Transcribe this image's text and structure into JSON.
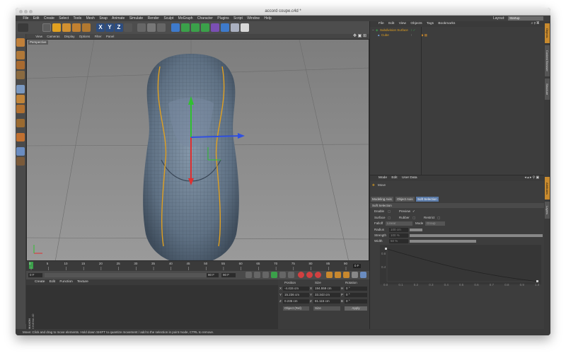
{
  "window": {
    "title": "accord coupe.c4d *"
  },
  "menu": {
    "items": [
      "File",
      "Edit",
      "Create",
      "Select",
      "Tools",
      "Mesh",
      "Snap",
      "Animate",
      "Simulate",
      "Render",
      "Sculpt",
      "MoGraph",
      "Character",
      "Plugins",
      "Script",
      "Window",
      "Help"
    ],
    "layout_label": "Layout:",
    "layout_value": "Startup"
  },
  "viewport": {
    "menu": [
      "View",
      "Cameras",
      "Display",
      "Options",
      "Filter",
      "Panel"
    ],
    "label": "Perspective"
  },
  "timeline": {
    "ticks": [
      "0",
      "5",
      "10",
      "15",
      "20",
      "25",
      "30",
      "35",
      "40",
      "45",
      "50",
      "55",
      "60",
      "65",
      "70",
      "75",
      "80",
      "85",
      "90"
    ],
    "end_frame": "0 F"
  },
  "playback": {
    "start_field": "0 F",
    "current_field": "0 F",
    "end_field": "90 F",
    "max_field": "90 F"
  },
  "material": {
    "menu": [
      "Create",
      "Edit",
      "Function",
      "Texture"
    ],
    "logo_line1": "MAXON",
    "logo_line2": "CINEMA 4D"
  },
  "coordinates": {
    "headers": [
      "Position",
      "Size",
      "Rotation"
    ],
    "rows": [
      {
        "axis": "X",
        "position": "-4.415 cm",
        "size_axis": "X",
        "size": "194.559 cm",
        "rot_axis": "H",
        "rotation": "0 °"
      },
      {
        "axis": "Y",
        "position": "15.236 cm",
        "size_axis": "Y",
        "size": "33.343 cm",
        "rot_axis": "P",
        "rotation": "0 °"
      },
      {
        "axis": "Z",
        "position": "0.235 cm",
        "size_axis": "Z",
        "size": "81.115 cm",
        "rot_axis": "B",
        "rotation": "0 °"
      }
    ],
    "mode": "Object (Rel)",
    "size_mode": "Size",
    "apply": "Apply"
  },
  "object_manager": {
    "menu": [
      "File",
      "Edit",
      "View",
      "Objects",
      "Tags",
      "Bookmarks"
    ],
    "objects": [
      {
        "name": "Subdivision Surface",
        "color": "#e0a020"
      },
      {
        "name": "Cube",
        "color": "#e0a020"
      }
    ]
  },
  "attribute_manager": {
    "menu": [
      "Mode",
      "Edit",
      "User Data"
    ],
    "tool_name": "Move",
    "tabs": [
      "Modeling Axis",
      "Object Axis",
      "Soft Selection"
    ],
    "active_tab": "Soft Selection",
    "section": "Soft Selection",
    "enable_label": "Enable",
    "preview_label": "Preview",
    "surface_label": "Surface",
    "rubber_label": "Rubber",
    "restrict_label": "Restrict",
    "falloff_label": "Falloff",
    "falloff_value": "Linear",
    "mode_label": "Mode",
    "mode_value": "Group",
    "radius_label": "Radius",
    "radius_value": "100 cm",
    "strength_label": "Strength",
    "strength_value": "100 %",
    "width_label": "Width",
    "width_value": "50 %",
    "graph_y_labels": [
      "0.8",
      "0.4"
    ],
    "graph_x_labels": [
      "0.0",
      "0.1",
      "0.2",
      "0.3",
      "0.4",
      "0.5",
      "0.6",
      "0.7",
      "0.8",
      "0.9",
      "1.0"
    ]
  },
  "right_tabs": [
    "Objects",
    "Content Browser",
    "Structure",
    "Attributes",
    "Layers"
  ],
  "status": {
    "text": "Move: Click and drag to move elements. Hold down SHIFT to quantize movement / add to the selection in point mode, CTRL to remove."
  },
  "colors": {
    "accent": "#c88a2e",
    "selection_tab": "#5a7aa8",
    "axis_x": "#e03030",
    "axis_y": "#30c030",
    "axis_z": "#3050e0",
    "car_body": "#6b7f93",
    "edge_loop": "#e0a020"
  }
}
